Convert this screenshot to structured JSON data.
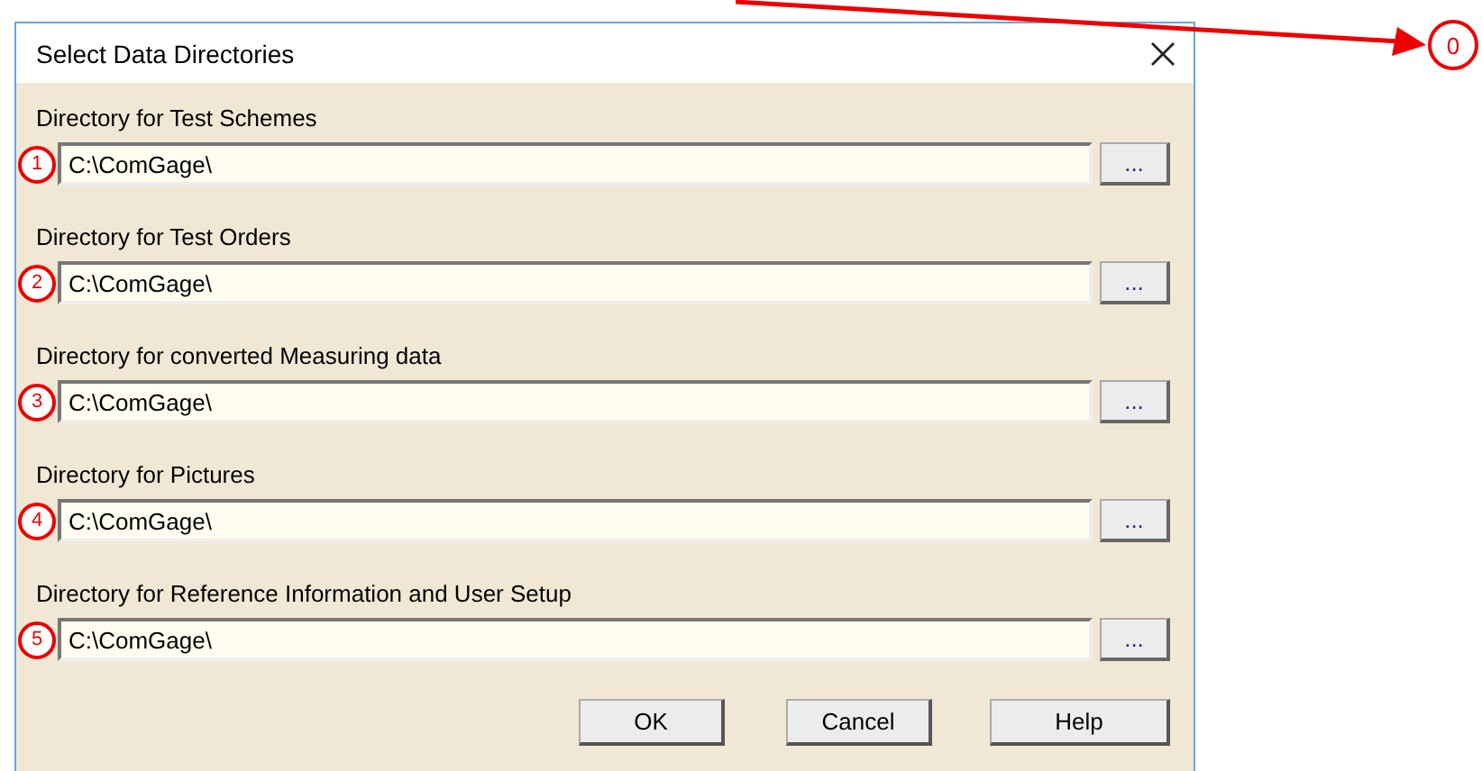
{
  "window": {
    "title": "Select Data Directories"
  },
  "directories": [
    {
      "label": "Directory for Test Schemes",
      "value": "C:\\ComGage\\",
      "marker": "1",
      "browse": "..."
    },
    {
      "label": "Directory for Test Orders",
      "value": "C:\\ComGage\\",
      "marker": "2",
      "browse": "..."
    },
    {
      "label": "Directory for converted Measuring data",
      "value": "C:\\ComGage\\",
      "marker": "3",
      "browse": "..."
    },
    {
      "label": "Directory for Pictures",
      "value": "C:\\ComGage\\",
      "marker": "4",
      "browse": "..."
    },
    {
      "label": "Directory for Reference Information and User Setup",
      "value": "C:\\ComGage\\",
      "marker": "5",
      "browse": "..."
    }
  ],
  "buttons": [
    "OK",
    "Cancel",
    "Help"
  ],
  "annotation": {
    "marker": "0"
  }
}
